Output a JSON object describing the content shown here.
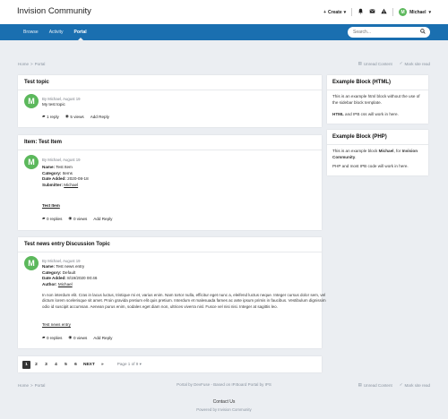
{
  "header": {
    "site_title": "Invision Community",
    "create_label": "Create",
    "user_name": "Michael",
    "user_initial": "M"
  },
  "nav": {
    "tabs": [
      {
        "label": "Browse"
      },
      {
        "label": "Activity"
      },
      {
        "label": "Portal"
      }
    ],
    "search_placeholder": "Search..."
  },
  "breadcrumb": {
    "home": "Home",
    "separator": ">",
    "current": "Portal",
    "unread": "Unread Content",
    "mark_read": "Mark site read"
  },
  "posts": [
    {
      "title": "Test topic",
      "avatar_initial": "M",
      "meta": "By Michael, August 19",
      "body": "My test topic",
      "replies": "1 reply",
      "views": "5 views",
      "add_reply": "Add Reply"
    },
    {
      "title": "Item: Test Item",
      "avatar_initial": "M",
      "meta": "By Michael, August 19",
      "fields": [
        {
          "label": "Name:",
          "value": "Test Item"
        },
        {
          "label": "Category:",
          "value": "Items"
        },
        {
          "label": "Date Added:",
          "value": "2020-08-18"
        },
        {
          "label": "Submitter:",
          "value": "Michael"
        }
      ],
      "link": "Test Item",
      "replies": "0 replies",
      "views": "0 views",
      "add_reply": "Add Reply"
    },
    {
      "title": "Test news entry Discussion Topic",
      "avatar_initial": "M",
      "meta": "By Michael, August 19",
      "fields": [
        {
          "label": "Name:",
          "value": "Test news entry"
        },
        {
          "label": "Category:",
          "value": "Default"
        },
        {
          "label": "Date Added:",
          "value": "8/19/2020 00:46"
        },
        {
          "label": "Author:",
          "value": "Michael"
        }
      ],
      "paragraph": "In non interdum elit. Cras in lacus luctus, tristique mi et, varius enim. Nam tortor nulla, efficitur eget nunc a, eleifend luctus neque. Integer cursus dolor sem, vel dictum lorem scelerisque sit amet. Proin gravida pretium elit quis pretium. Interdum et malesuada fames ac ante ipsum primis in faucibus. Vestibulum dignissim odio id suscipit accumsan. Aenean purus enim, sodales eget diam non, ultrices viverra nisl. Fusce vel nisi nisi. Integer at sagittis leo.",
      "link": "Test news entry",
      "replies": "0 replies",
      "views": "0 views",
      "add_reply": "Add Reply"
    }
  ],
  "sidebar": {
    "blocks": [
      {
        "title": "Example Block (HTML)",
        "line1": "This is an example html block without the use of the sidebar block template.",
        "line2_bold": "HTML",
        "line2_rest": " and IPB css will work in here."
      },
      {
        "title": "Example Block (PHP)",
        "line1_a": "This is an example block ",
        "line1_b": "Michael",
        "line1_c": ", for ",
        "line1_d": "Invision Community",
        "line1_e": ".",
        "line2": "PHP and most IPB code will work in here."
      }
    ]
  },
  "pagination": {
    "pages": [
      "1",
      "2",
      "3",
      "4",
      "5",
      "6"
    ],
    "next": "NEXT",
    "last": "»",
    "page_of": "Page 1 of 9"
  },
  "footer": {
    "credit": "Portal by DevFuse - Based on IP.Board Portal by IPS",
    "contact": "Contact Us",
    "powered": "Powered by Invision Community"
  },
  "colors": {
    "nav_blue": "#1a6fb0",
    "avatar_green": "#5cb85c",
    "page_bg": "#ebeef2"
  }
}
